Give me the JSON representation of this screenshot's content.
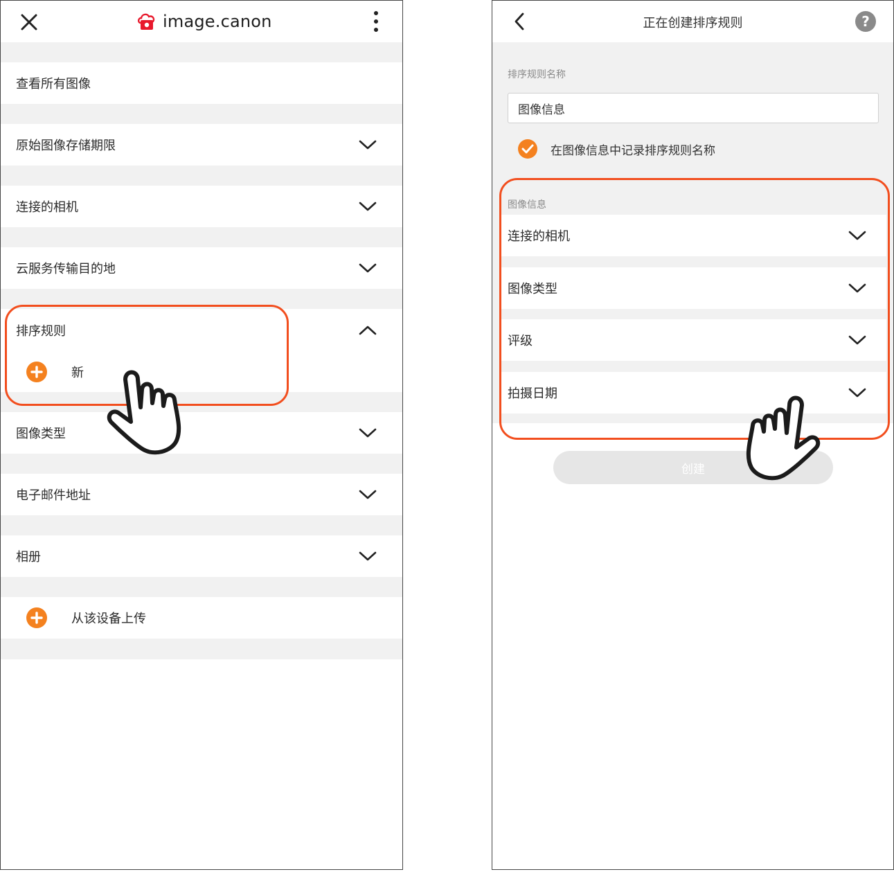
{
  "colors": {
    "accent": "#f4811f",
    "highlight": "#f24e1e",
    "brand_red": "#e8192c"
  },
  "left": {
    "header": {
      "logo_text": "image.canon",
      "close_icon": "close-icon",
      "more_icon": "more-vertical-icon"
    },
    "menu": {
      "view_all": "查看所有图像",
      "original_storage": "原始图像存储期限",
      "connected_camera": "连接的相机",
      "cloud_destination": "云服务传输目的地",
      "sort_rules": "排序规则",
      "new_rule": "新",
      "image_type": "图像类型",
      "email": "电子邮件地址",
      "album": "相册",
      "upload": "从该设备上传"
    }
  },
  "right": {
    "header": {
      "title": "正在创建排序规则",
      "back_icon": "chevron-left-icon",
      "help_icon": "help-icon"
    },
    "rule_name_label": "排序规则名称",
    "rule_name_value": "图像信息",
    "record_checkbox_label": "在图像信息中记录排序规则名称",
    "record_checked": true,
    "info_label": "图像信息",
    "conditions": {
      "camera": "连接的相机",
      "image_type": "图像类型",
      "rating": "评级",
      "shoot_date": "拍摄日期"
    },
    "create_button": "创建"
  }
}
